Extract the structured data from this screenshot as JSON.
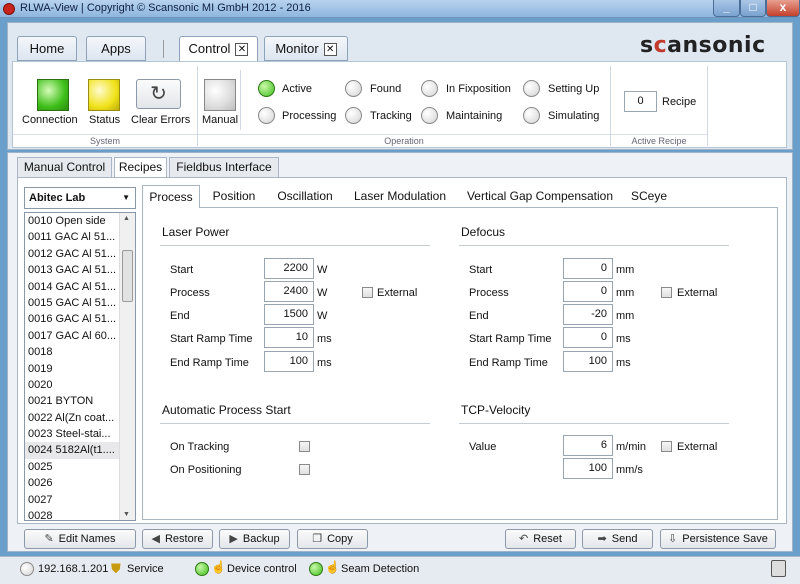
{
  "window": {
    "title": "RLWA-View | Copyright © Scansonic MI GmbH 2012 - 2016",
    "min": "_",
    "max": "□",
    "close": "x"
  },
  "tabs": {
    "home": "Home",
    "apps": "Apps",
    "control": "Control",
    "monitor": "Monitor",
    "close_glyph": "✕"
  },
  "logo": {
    "pre": "s",
    "accent": "c",
    "post": "ansonic"
  },
  "ribbon": {
    "system": {
      "label": "System",
      "connection": "Connection",
      "status": "Status",
      "clear_errors": "Clear Errors"
    },
    "operation": {
      "label": "Operation",
      "manual": "Manual",
      "active": "Active",
      "processing": "Processing",
      "found": "Found",
      "tracking": "Tracking",
      "in_fixposition": "In Fixposition",
      "maintaining": "Maintaining",
      "setting_up": "Setting Up",
      "simulating": "Simulating"
    },
    "active_recipe": {
      "label": "Active Recipe",
      "value": "0",
      "recipe": "Recipe"
    }
  },
  "subtabs": [
    "Manual Control",
    "Recipes",
    "Fieldbus Interface"
  ],
  "lab_select": "Abitec Lab",
  "recipes": [
    "0010  Open side",
    "0011  GAC Al 51...",
    "0012  GAC Al 51...",
    "0013  GAC Al 51...",
    "0014  GAC Al 51...",
    "0015  GAC Al 51...",
    "0016  GAC Al 51...",
    "0017  GAC Al 60...",
    "0018",
    "0019",
    "0020",
    "0021  BYTON",
    "0022  Al(Zn coat...",
    "0023  Steel-stai...",
    "0024  5182Al(t1....",
    "0025",
    "0026",
    "0027",
    "0028"
  ],
  "process_tabs": [
    "Process",
    "Position",
    "Oscillation",
    "Laser Modulation",
    "Vertical Gap Compensation",
    "SCeye"
  ],
  "laser_power": {
    "title": "Laser Power",
    "start": "Start",
    "start_v": "2200",
    "process": "Process",
    "process_v": "2400",
    "end": "End",
    "end_v": "1500",
    "ramp_start": "Start Ramp Time",
    "ramp_start_v": "10",
    "ramp_end": "End Ramp Time",
    "ramp_end_v": "100",
    "unit_w": "W",
    "unit_ms": "ms",
    "external": "External"
  },
  "defocus": {
    "title": "Defocus",
    "start": "Start",
    "start_v": "0",
    "process": "Process",
    "process_v": "0",
    "end": "End",
    "end_v": "-20",
    "ramp_start": "Start Ramp Time",
    "ramp_start_v": "0",
    "ramp_end": "End Ramp Time",
    "ramp_end_v": "100",
    "unit_mm": "mm",
    "unit_ms": "ms",
    "external": "External"
  },
  "auto_start": {
    "title": "Automatic Process Start",
    "on_tracking": "On Tracking",
    "on_positioning": "On Positioning"
  },
  "tcp": {
    "title": "TCP-Velocity",
    "value": "Value",
    "value_v": "6",
    "unit1": "m/min",
    "value2_v": "100",
    "unit2": "mm/s",
    "external": "External"
  },
  "buttons": {
    "edit_names": "Edit Names",
    "restore": "Restore",
    "backup": "Backup",
    "copy": "Copy",
    "reset": "Reset",
    "send": "Send",
    "persistence_save": "Persistence Save"
  },
  "status": {
    "ip": "192.168.1.201",
    "service": "Service",
    "device_control": "Device control",
    "seam_detection": "Seam Detection"
  },
  "colors": {
    "green": "#3fbf1a",
    "yellow": "#f0e21a",
    "accent": "#c0392b"
  }
}
